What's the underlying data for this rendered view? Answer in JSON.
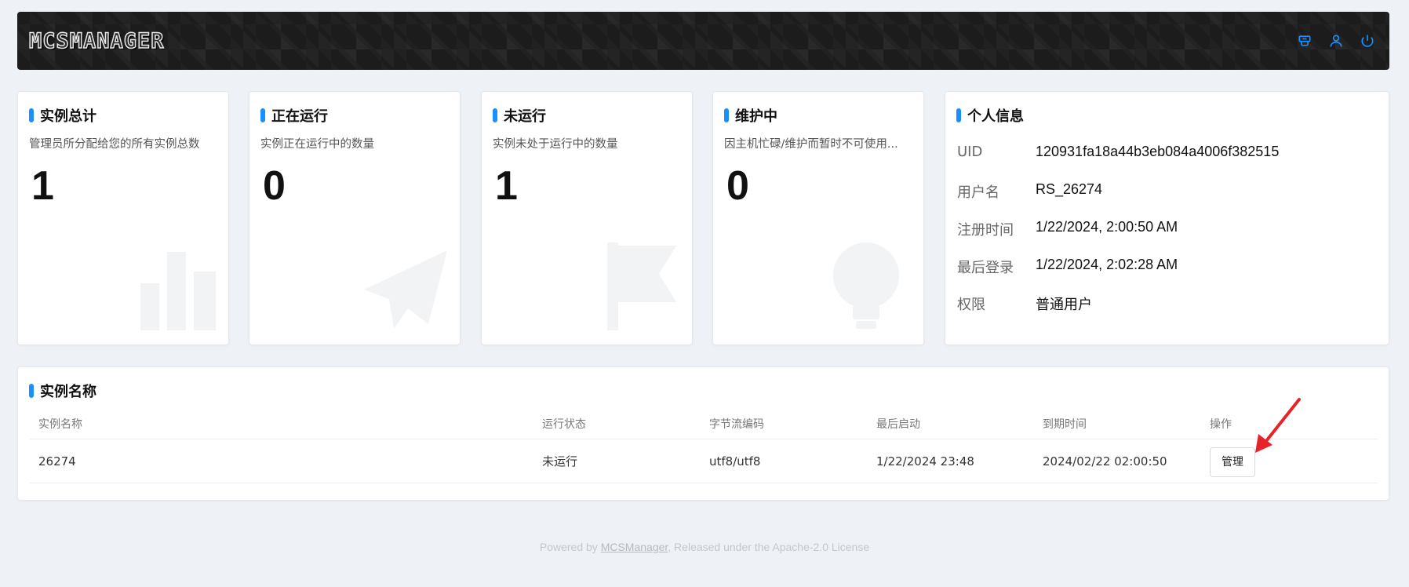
{
  "header": {
    "logo": "MCSMANAGER",
    "actions": [
      {
        "icon": "ticket-icon"
      },
      {
        "icon": "user-icon"
      },
      {
        "icon": "power-icon"
      }
    ]
  },
  "stats": [
    {
      "title": "实例总计",
      "desc": "管理员所分配给您的所有实例总数",
      "value": "1",
      "icon": "bar-chart-icon"
    },
    {
      "title": "正在运行",
      "desc": "实例正在运行中的数量",
      "value": "0",
      "icon": "paper-plane-icon"
    },
    {
      "title": "未运行",
      "desc": "实例未处于运行中的数量",
      "value": "1",
      "icon": "flag-icon"
    },
    {
      "title": "维护中",
      "desc": "因主机忙碌/维护而暂时不可使用...",
      "value": "0",
      "icon": "bulb-icon"
    }
  ],
  "profile": {
    "title": "个人信息",
    "rows": [
      {
        "key": "UID",
        "value": "120931fa18a44b3eb084a4006f382515"
      },
      {
        "key": "用户名",
        "value": "RS_26274"
      },
      {
        "key": "注册时间",
        "value": "1/22/2024, 2:00:50 AM"
      },
      {
        "key": "最后登录",
        "value": "1/22/2024, 2:02:28 AM"
      },
      {
        "key": "权限",
        "value": "普通用户"
      }
    ]
  },
  "instances": {
    "title": "实例名称",
    "columns": [
      "实例名称",
      "运行状态",
      "字节流编码",
      "最后启动",
      "到期时间",
      "操作"
    ],
    "rows": [
      {
        "name": "26274",
        "status": "未运行",
        "encoding": "utf8/utf8",
        "last_start": "1/22/2024 23:48",
        "expire": "2024/02/22 02:00:50",
        "action": "管理"
      }
    ]
  },
  "footer": {
    "prefix": "Powered by ",
    "link": "MCSManager",
    "suffix": ", Released under the Apache-2.0 License"
  },
  "colors": {
    "accent": "#1890ff",
    "annotation_arrow": "#e8222a"
  }
}
